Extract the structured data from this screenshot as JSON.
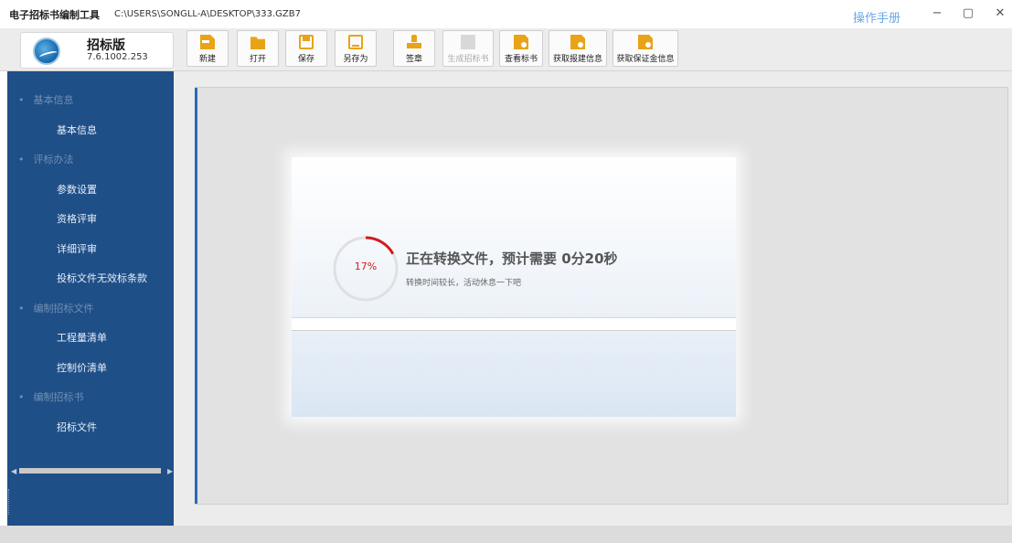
{
  "titlebar": {
    "app_title": "电子招标书编制工具",
    "file_path": "C:\\USERS\\SONGLL-A\\DESKTOP\\333.GZB7",
    "manual_link": "操作手册",
    "minimize": "−",
    "restore": "▢",
    "close": "✕"
  },
  "brand": {
    "edition": "招标版",
    "version": "7.6.1002.253",
    "logo_icon": "globe-logo"
  },
  "toolbar": {
    "buttons": [
      {
        "label": "新建",
        "icon": "new-file-icon",
        "enabled": true
      },
      {
        "label": "打开",
        "icon": "folder-open-icon",
        "enabled": true
      },
      {
        "label": "保存",
        "icon": "save-icon",
        "enabled": true
      },
      {
        "label": "另存为",
        "icon": "save-as-icon",
        "enabled": true
      },
      {
        "label": "签章",
        "icon": "stamp-icon",
        "enabled": true
      },
      {
        "label": "生成招标书",
        "icon": "generate-icon",
        "enabled": false
      },
      {
        "label": "查看标书",
        "icon": "view-doc-icon",
        "enabled": true
      },
      {
        "label": "获取报建信息",
        "icon": "fetch-info-icon",
        "enabled": true
      },
      {
        "label": "获取保证金信息",
        "icon": "fetch-deposit-icon",
        "enabled": true
      }
    ]
  },
  "sidebar": {
    "sections": [
      {
        "title": "基本信息",
        "items": [
          "基本信息"
        ]
      },
      {
        "title": "评标办法",
        "items": [
          "参数设置",
          "资格评审",
          "详细评审",
          "投标文件无效标条款"
        ]
      },
      {
        "title": "编制招标文件",
        "items": [
          "工程量清单",
          "控制价清单"
        ]
      },
      {
        "title": "编制招标书",
        "items": [
          "招标文件"
        ]
      }
    ],
    "scroll_left": "◀",
    "scroll_right": "▶"
  },
  "dialog": {
    "progress_percent": 17,
    "progress_label": "17%",
    "title": "正在转换文件，预计需要  0分20秒",
    "subtitle": "转换时间较长，活动休息一下吧"
  },
  "colors": {
    "sidebar_bg": "#1f4f87",
    "accent_icon": "#e8a317",
    "progress_red": "#d6191b",
    "manual_link": "#6aa8e6"
  }
}
